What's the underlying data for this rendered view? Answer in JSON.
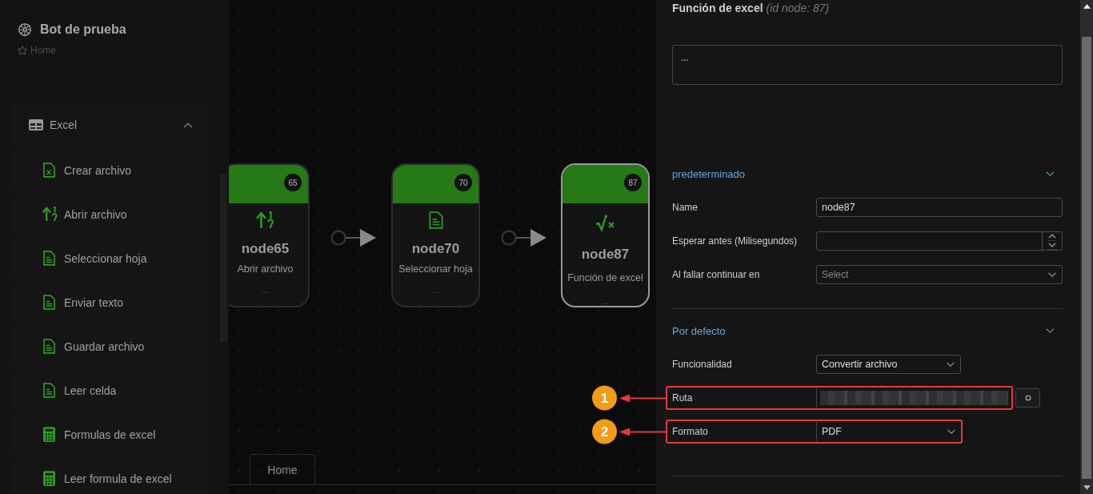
{
  "sidebar": {
    "title": "Bot de prueba",
    "breadcrumb": "Home",
    "group": {
      "label": "Excel",
      "expanded": true,
      "items": [
        {
          "label": "Crear archivo",
          "kind": "create"
        },
        {
          "label": "Abrir archivo",
          "kind": "open"
        },
        {
          "label": "Seleccionar hoja",
          "kind": "sheet"
        },
        {
          "label": "Enviar texto",
          "kind": "sheet"
        },
        {
          "label": "Guardar archivo",
          "kind": "sheet"
        },
        {
          "label": "Leer celda",
          "kind": "sheet"
        },
        {
          "label": "Formulas de excel",
          "kind": "formula"
        },
        {
          "label": "Leer formula de excel",
          "kind": "formula"
        }
      ]
    }
  },
  "canvas": {
    "nodes": [
      {
        "id": "65",
        "name": "node65",
        "subtitle": "Abrir archivo",
        "footer": "...",
        "kind": "open",
        "selected": false
      },
      {
        "id": "70",
        "name": "node70",
        "subtitle": "Seleccionar hoja",
        "footer": "...",
        "kind": "sheet",
        "selected": false
      },
      {
        "id": "87",
        "name": "node87",
        "subtitle": "Función de excel",
        "footer": "...",
        "kind": "function",
        "selected": true
      }
    ],
    "tab": "Home"
  },
  "panel": {
    "title": "Función de excel",
    "title_note": "(id node: 87)",
    "description": "...",
    "sections": [
      {
        "title": "predeterminado",
        "expanded": true,
        "fields": [
          {
            "label": "Name",
            "kind": "text",
            "value": "node87"
          },
          {
            "label": "Esperar antes (Milisegundos)",
            "kind": "number"
          },
          {
            "label": "Al fallar continuar en",
            "kind": "select",
            "placeholder": "Select"
          }
        ]
      },
      {
        "title": "Por defecto",
        "expanded": true,
        "fields": [
          {
            "label": "Funcionalidad",
            "kind": "select-short",
            "value": "Convertir archivo"
          },
          {
            "label": "Ruta",
            "kind": "path",
            "annotation": "1"
          },
          {
            "label": "Formato",
            "kind": "select-short",
            "value": "PDF",
            "annotation": "2"
          }
        ]
      }
    ]
  }
}
